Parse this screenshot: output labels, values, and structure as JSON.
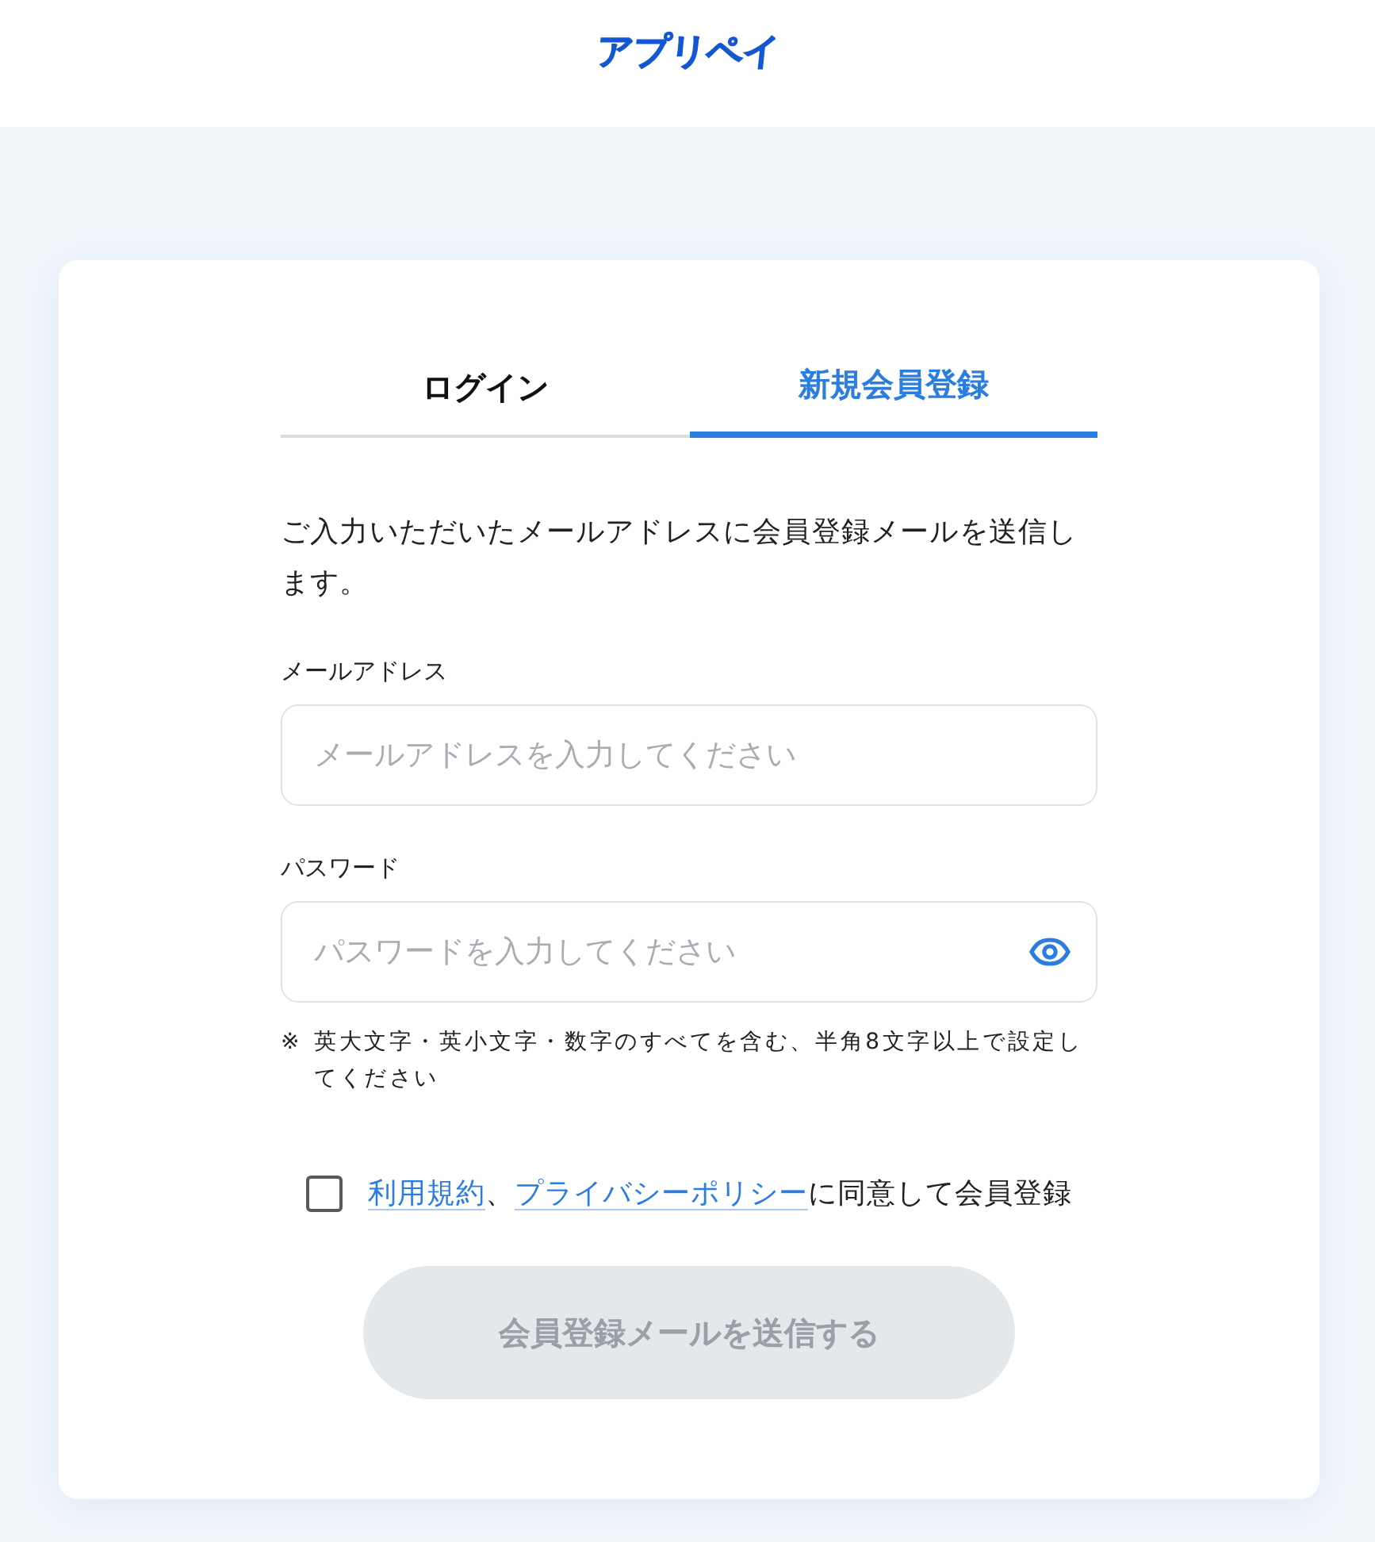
{
  "header": {
    "logo": "アプリペイ"
  },
  "tabs": [
    {
      "label": "ログイン",
      "selected": false
    },
    {
      "label": "新規会員登録",
      "selected": true
    }
  ],
  "intro": "ご入力いただいたメールアドレスに会員登録メールを送信します。",
  "fields": [
    {
      "kind": "email",
      "label": "メールアドレス",
      "placeholder": "メールアドレスを入力してください"
    },
    {
      "kind": "password",
      "label": "パスワード",
      "placeholder": "パスワードを入力してください",
      "note_mark": "※",
      "note": "英大文字・英小文字・数字のすべてを含む、半角8文字以上で設定してください"
    }
  ],
  "agreement": {
    "checked": false,
    "links": [
      "利用規約",
      "プライバシーポリシー"
    ],
    "separator": "、",
    "text": "に同意して会員登録"
  },
  "submit": {
    "label": "会員登録メールを送信する",
    "disabled": true
  }
}
